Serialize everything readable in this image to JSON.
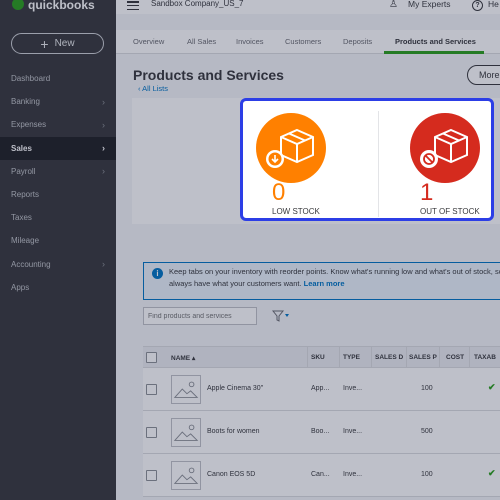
{
  "app": {
    "logo_small": "intuit",
    "logo": "quickbooks",
    "brand_color": "#2ca01c"
  },
  "sidebar": {
    "new_label": "New",
    "items": [
      {
        "label": "Dashboard",
        "chevron": false
      },
      {
        "label": "Banking",
        "chevron": true
      },
      {
        "label": "Expenses",
        "chevron": true
      },
      {
        "label": "Sales",
        "chevron": true,
        "active": true
      },
      {
        "label": "Payroll",
        "chevron": true
      },
      {
        "label": "Reports",
        "chevron": false
      },
      {
        "label": "Taxes",
        "chevron": false
      },
      {
        "label": "Mileage",
        "chevron": false
      },
      {
        "label": "Accounting",
        "chevron": true
      },
      {
        "label": "Apps",
        "chevron": false
      }
    ]
  },
  "topbar": {
    "company": "Sandbox Company_US_7",
    "my_experts": "My Experts",
    "help": "He"
  },
  "tabs": [
    {
      "label": "Overview"
    },
    {
      "label": "All Sales"
    },
    {
      "label": "Invoices"
    },
    {
      "label": "Customers"
    },
    {
      "label": "Deposits"
    },
    {
      "label": "Products and Services",
      "active": true
    }
  ],
  "page": {
    "title": "Products and Services",
    "all_lists": "All Lists",
    "more_label": "More"
  },
  "stock": {
    "low": {
      "count": "0",
      "label": "LOW STOCK",
      "color": "#ff8000"
    },
    "out": {
      "count": "1",
      "label": "OUT OF STOCK",
      "color": "#d52b1e"
    }
  },
  "banner": {
    "text": "Keep tabs on your inventory with reorder points. Know what's running low and what's out of stock, so you always have what your customers want.",
    "link": "Learn more"
  },
  "search": {
    "placeholder": "Find products and services"
  },
  "table": {
    "columns": [
      "NAME",
      "SKU",
      "TYPE",
      "SALES D",
      "SALES P",
      "COST",
      "TAXAB"
    ],
    "rows": [
      {
        "name": "Apple Cinema 30\"",
        "sku": "App...",
        "type": "Inve...",
        "sales_desc": "",
        "sales_price": "100",
        "cost": "",
        "taxable": true
      },
      {
        "name": "Boots for women",
        "sku": "Boo...",
        "type": "Inve...",
        "sales_desc": "",
        "sales_price": "500",
        "cost": "",
        "taxable": false
      },
      {
        "name": "Canon EOS 5D",
        "sku": "Can...",
        "type": "Inve...",
        "sales_desc": "",
        "sales_price": "100",
        "cost": "",
        "taxable": true
      }
    ]
  }
}
